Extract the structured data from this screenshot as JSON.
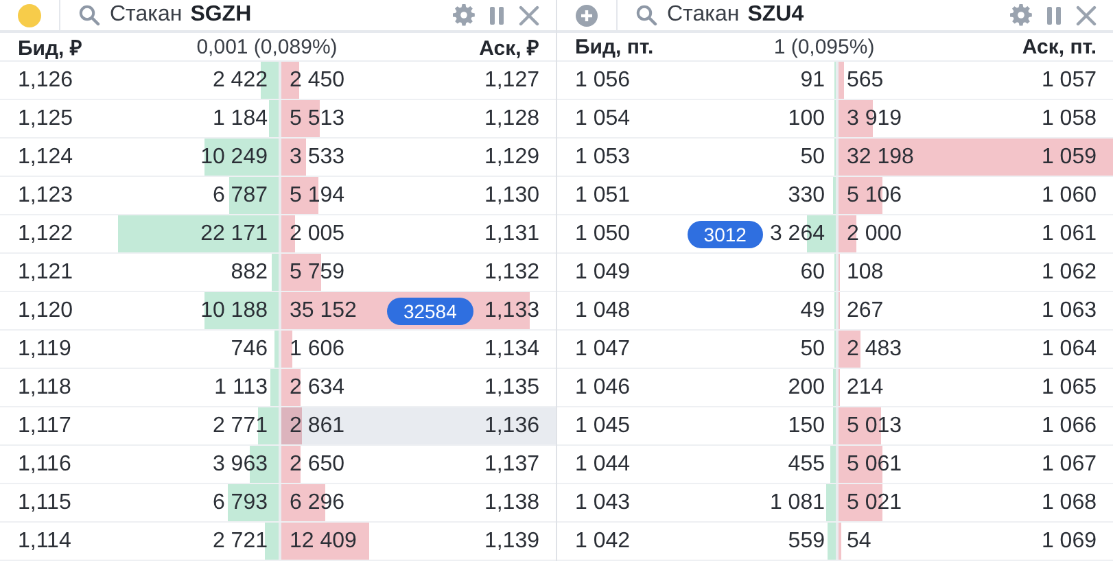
{
  "panels": [
    {
      "link": {
        "kind": "dot",
        "color": "#f7cc4a"
      },
      "title": "Стакан",
      "ticker": "SGZH",
      "columns": {
        "bid": "Бид, ₽",
        "spread": "0,001 (0,089%)",
        "ask": "Аск, ₽"
      },
      "rows": [
        {
          "bid_price": "1,126",
          "bid_volume": {
            "text": "2 422",
            "level": 0.065
          },
          "ask_volume": {
            "text": "2 450",
            "level": 0.065
          },
          "ask_price": "1,127",
          "highlighted": false
        },
        {
          "bid_price": "1,125",
          "bid_volume": {
            "text": "1 184",
            "level": 0.035
          },
          "ask_volume": {
            "text": "5 513",
            "level": 0.14
          },
          "ask_price": "1,128",
          "highlighted": false
        },
        {
          "bid_price": "1,124",
          "bid_volume": {
            "text": "10 249",
            "level": 0.265
          },
          "ask_volume": {
            "text": "3 533",
            "level": 0.09
          },
          "ask_price": "1,129",
          "highlighted": false
        },
        {
          "bid_price": "1,123",
          "bid_volume": {
            "text": "6 787",
            "level": 0.175
          },
          "ask_volume": {
            "text": "5 194",
            "level": 0.135
          },
          "ask_price": "1,130",
          "highlighted": false
        },
        {
          "bid_price": "1,122",
          "bid_volume": {
            "text": "22 171",
            "level": 0.575
          },
          "ask_volume": {
            "text": "2 005",
            "level": 0.05
          },
          "ask_price": "1,131",
          "highlighted": false
        },
        {
          "bid_price": "1,121",
          "bid_volume": {
            "text": "882",
            "level": 0.025
          },
          "ask_volume": {
            "text": "5 759",
            "level": 0.145
          },
          "ask_price": "1,132",
          "highlighted": false
        },
        {
          "bid_price": "1,120",
          "bid_volume": {
            "text": "10 188",
            "level": 0.265
          },
          "ask_volume": {
            "text": "35 152",
            "level": 0.905
          },
          "ask_order": "32584",
          "ask_price": "1,133",
          "highlighted": false
        },
        {
          "bid_price": "1,119",
          "bid_volume": {
            "text": "746",
            "level": 0.015
          },
          "ask_volume": {
            "text": "1 606",
            "level": 0.04
          },
          "ask_price": "1,134",
          "highlighted": false
        },
        {
          "bid_price": "1,118",
          "bid_volume": {
            "text": "1 113",
            "level": 0.03
          },
          "ask_volume": {
            "text": "2 634",
            "level": 0.07
          },
          "ask_price": "1,135",
          "highlighted": false
        },
        {
          "bid_price": "1,117",
          "bid_volume": {
            "text": "2 771",
            "level": 0.075
          },
          "ask_volume": {
            "text": "2 861",
            "level": 0.075
          },
          "ask_price": "1,136",
          "highlighted": true
        },
        {
          "bid_price": "1,116",
          "bid_volume": {
            "text": "3 963",
            "level": 0.105
          },
          "ask_volume": {
            "text": "2 650",
            "level": 0.07
          },
          "ask_price": "1,137",
          "highlighted": false
        },
        {
          "bid_price": "1,115",
          "bid_volume": {
            "text": "6 793",
            "level": 0.18
          },
          "ask_volume": {
            "text": "6 296",
            "level": 0.16
          },
          "ask_price": "1,138",
          "highlighted": false
        },
        {
          "bid_price": "1,114",
          "bid_volume": {
            "text": "2 721",
            "level": 0.05
          },
          "ask_volume": {
            "text": "12 409",
            "level": 0.32
          },
          "ask_price": "1,139",
          "highlighted": false
        }
      ]
    },
    {
      "link": {
        "kind": "add"
      },
      "title": "Стакан",
      "ticker": "SZU4",
      "columns": {
        "bid": "Бид, пт.",
        "spread": "1 (0,095%)",
        "ask": "Аск, пт."
      },
      "rows": [
        {
          "bid_price": "1 056",
          "bid_volume": {
            "text": "91",
            "level": 0.004
          },
          "ask_volume": {
            "text": "565",
            "level": 0.02
          },
          "ask_price": "1 057",
          "highlighted": false
        },
        {
          "bid_price": "1 054",
          "bid_volume": {
            "text": "100",
            "level": 0.004
          },
          "ask_volume": {
            "text": "3 919",
            "level": 0.125
          },
          "ask_price": "1 058",
          "highlighted": false
        },
        {
          "bid_price": "1 053",
          "bid_volume": {
            "text": "50",
            "level": 0.003
          },
          "ask_volume": {
            "text": "32 198",
            "level": 1.0
          },
          "ask_price": "1 059",
          "highlighted": false
        },
        {
          "bid_price": "1 051",
          "bid_volume": {
            "text": "330",
            "level": 0.01
          },
          "ask_volume": {
            "text": "5 106",
            "level": 0.16
          },
          "ask_price": "1 060",
          "highlighted": false
        },
        {
          "bid_price": "1 050",
          "bid_order": "3012",
          "bid_volume": {
            "text": "3 264",
            "level": 0.105
          },
          "ask_volume": {
            "text": "2 000",
            "level": 0.065
          },
          "ask_price": "1 061",
          "highlighted": false
        },
        {
          "bid_price": "1 049",
          "bid_volume": {
            "text": "60",
            "level": 0.005
          },
          "ask_volume": {
            "text": "108",
            "level": 0.005
          },
          "ask_price": "1 062",
          "highlighted": false
        },
        {
          "bid_price": "1 048",
          "bid_volume": {
            "text": "49",
            "level": 0.005
          },
          "ask_volume": {
            "text": "267",
            "level": 0.005
          },
          "ask_price": "1 063",
          "highlighted": false
        },
        {
          "bid_price": "1 047",
          "bid_volume": {
            "text": "50",
            "level": 0.005
          },
          "ask_volume": {
            "text": "2 483",
            "level": 0.08
          },
          "ask_price": "1 064",
          "highlighted": false
        },
        {
          "bid_price": "1 046",
          "bid_volume": {
            "text": "200",
            "level": 0.01
          },
          "ask_volume": {
            "text": "214",
            "level": 0.005
          },
          "ask_price": "1 065",
          "highlighted": false
        },
        {
          "bid_price": "1 045",
          "bid_volume": {
            "text": "150",
            "level": 0.01
          },
          "ask_volume": {
            "text": "5 013",
            "level": 0.155
          },
          "ask_price": "1 066",
          "highlighted": false
        },
        {
          "bid_price": "1 044",
          "bid_volume": {
            "text": "455",
            "level": 0.02
          },
          "ask_volume": {
            "text": "5 061",
            "level": 0.16
          },
          "ask_price": "1 067",
          "highlighted": false
        },
        {
          "bid_price": "1 043",
          "bid_volume": {
            "text": "1 081",
            "level": 0.035
          },
          "ask_volume": {
            "text": "5 021",
            "level": 0.16
          },
          "ask_price": "1 068",
          "highlighted": false
        },
        {
          "bid_price": "1 042",
          "bid_volume": {
            "text": "559",
            "level": 0.03
          },
          "ask_volume": {
            "text": "54",
            "level": 0.01
          },
          "ask_price": "1 069",
          "highlighted": false
        }
      ]
    }
  ]
}
